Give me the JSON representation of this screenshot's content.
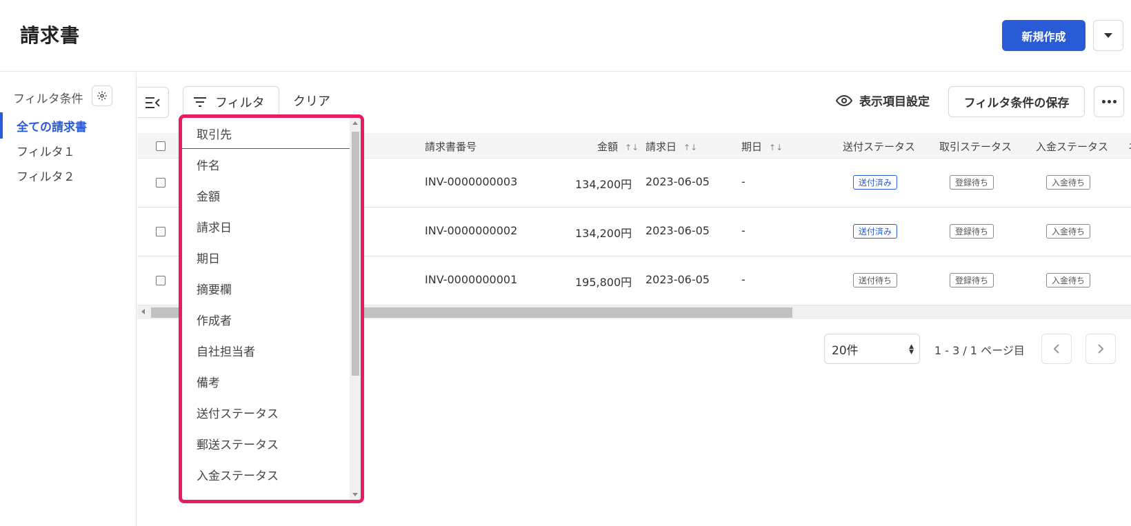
{
  "header": {
    "title": "請求書",
    "new_button": "新規作成"
  },
  "sidebar": {
    "label": "フィルタ条件",
    "items": [
      {
        "label": "全ての請求書"
      },
      {
        "label": "フィルタ１"
      },
      {
        "label": "フィルタ２"
      }
    ]
  },
  "toolbar": {
    "filter_label": "フィルタ",
    "clear_label": "クリア",
    "column_settings_label": "表示項目設定",
    "save_filter_label": "フィルタ条件の保存"
  },
  "table": {
    "headers": {
      "invoice_number": "請求書番号",
      "amount": "金額",
      "invoice_date": "請求日",
      "due_date": "期日",
      "send_status": "送付ステータス",
      "trade_status": "取引ステータス",
      "payment_status": "入金ステータス",
      "extra": "ネ"
    },
    "rows": [
      {
        "invoice_number": "INV-0000000003",
        "amount": "134,200円",
        "invoice_date": "2023-06-05",
        "due_date": "-",
        "send_status": "送付済み",
        "trade_status": "登録待ち",
        "payment_status": "入金待ち"
      },
      {
        "invoice_number": "INV-0000000002",
        "amount": "134,200円",
        "invoice_date": "2023-06-05",
        "due_date": "-",
        "send_status": "送付済み",
        "trade_status": "登録待ち",
        "payment_status": "入金待ち"
      },
      {
        "invoice_number": "INV-0000000001",
        "amount": "195,800円",
        "invoice_date": "2023-06-05",
        "due_date": "-",
        "send_status": "送付待ち",
        "trade_status": "登録待ち",
        "payment_status": "入金待ち"
      }
    ]
  },
  "pagination": {
    "per_page": "20件",
    "info": "1 - 3 / 1 ページ目"
  },
  "filter_dropdown": {
    "items": [
      {
        "label": "取引先"
      },
      {
        "label": "件名"
      },
      {
        "label": "金額"
      },
      {
        "label": "請求日"
      },
      {
        "label": "期日"
      },
      {
        "label": "摘要欄"
      },
      {
        "label": "作成者"
      },
      {
        "label": "自社担当者"
      },
      {
        "label": "備考"
      },
      {
        "label": "送付ステータス"
      },
      {
        "label": "郵送ステータス"
      },
      {
        "label": "入金ステータス"
      }
    ]
  },
  "colors": {
    "accent": "#2a5bd7",
    "highlight_border": "#e81c63"
  }
}
